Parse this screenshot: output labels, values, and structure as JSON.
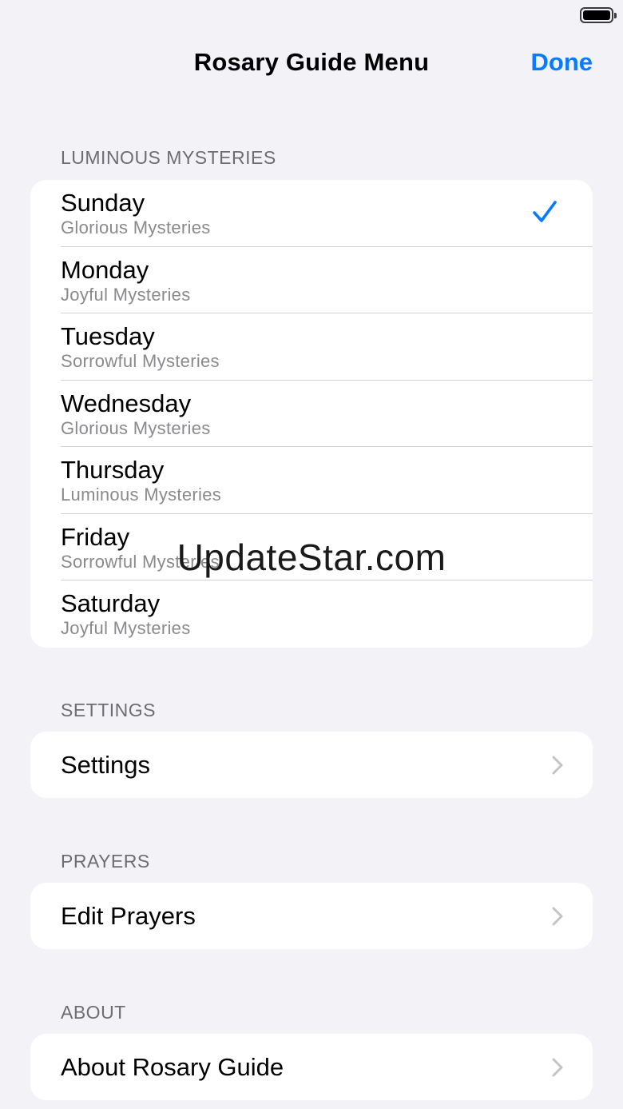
{
  "nav": {
    "title": "Rosary Guide Menu",
    "done_label": "Done"
  },
  "sections": {
    "luminous": {
      "header": "LUMINOUS MYSTERIES",
      "days": [
        {
          "day": "Sunday",
          "mystery": "Glorious Mysteries",
          "selected": true
        },
        {
          "day": "Monday",
          "mystery": "Joyful Mysteries",
          "selected": false
        },
        {
          "day": "Tuesday",
          "mystery": "Sorrowful Mysteries",
          "selected": false
        },
        {
          "day": "Wednesday",
          "mystery": "Glorious Mysteries",
          "selected": false
        },
        {
          "day": "Thursday",
          "mystery": "Luminous Mysteries",
          "selected": false
        },
        {
          "day": "Friday",
          "mystery": "Sorrowful Mysteries",
          "selected": false
        },
        {
          "day": "Saturday",
          "mystery": "Joyful Mysteries",
          "selected": false
        }
      ]
    },
    "settings": {
      "header": "SETTINGS",
      "item_label": "Settings"
    },
    "prayers": {
      "header": "PRAYERS",
      "item_label": "Edit Prayers"
    },
    "about": {
      "header": "ABOUT",
      "item_label": "About Rosary Guide"
    }
  },
  "watermark": "UpdateStar.com",
  "icons": {
    "selected": "checkmark-icon",
    "disclosure": "chevron-right-icon",
    "battery": "battery-icon"
  },
  "colors": {
    "accent": "#0a7aff",
    "background": "#f2f2f7",
    "secondary_text": "#8a8a8e",
    "chevron": "#c4c4c7"
  }
}
